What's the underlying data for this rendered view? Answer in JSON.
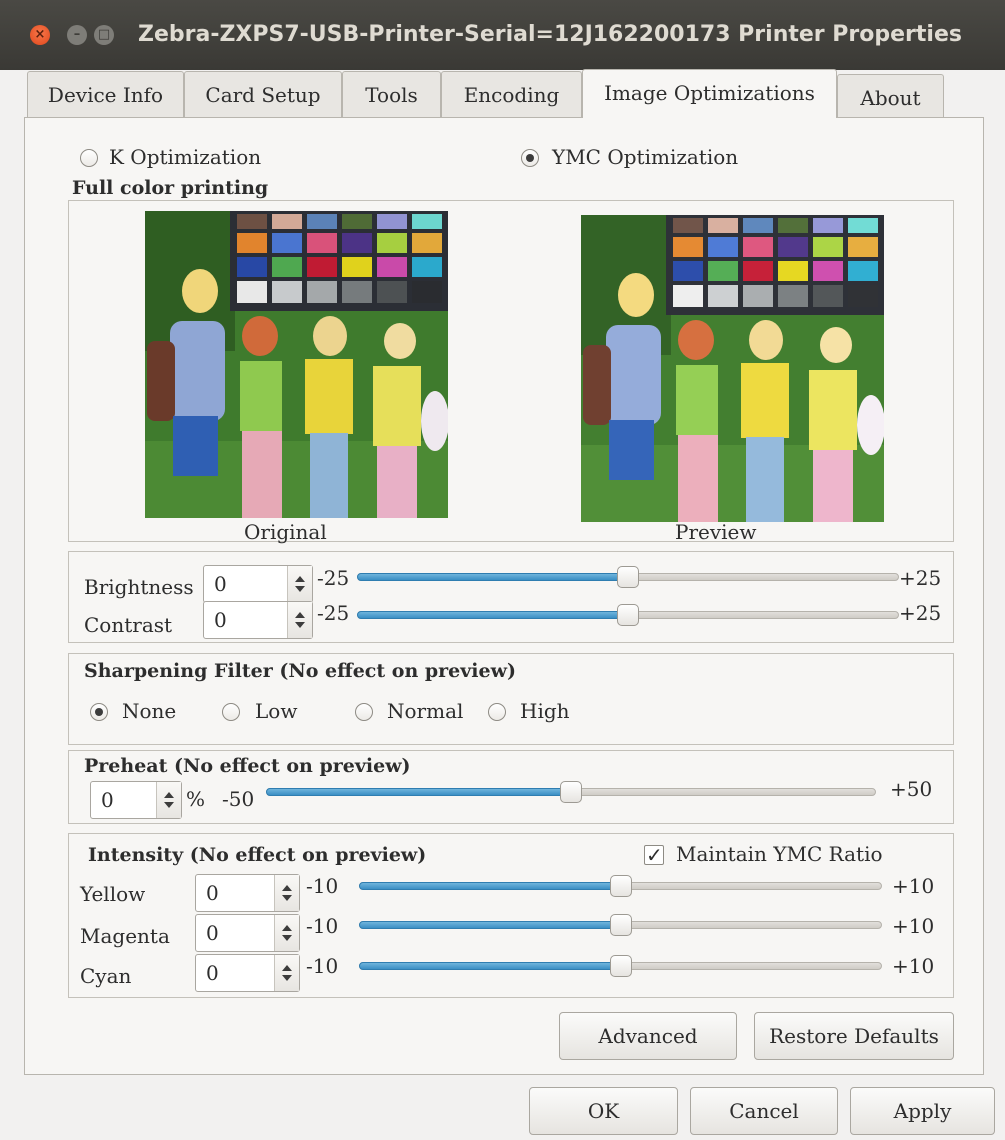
{
  "window": {
    "title": "Zebra-ZXPS7-USB-Printer-Serial=12J162200173 Printer Properties",
    "close_glyph": "×",
    "min_glyph": "–",
    "max_glyph": "□"
  },
  "tabs": [
    {
      "label": "Device Info"
    },
    {
      "label": "Card Setup"
    },
    {
      "label": "Tools"
    },
    {
      "label": "Encoding"
    },
    {
      "label": "Image Optimizations",
      "active": true
    },
    {
      "label": "About"
    }
  ],
  "optimization": {
    "k_label": "K Optimization",
    "ymc_label": "YMC Optimization",
    "selected": "YMC Optimization"
  },
  "full_color": {
    "heading": "Full color printing",
    "original_caption": "Original",
    "preview_caption": "Preview"
  },
  "adjust": {
    "brightness": {
      "label": "Brightness",
      "value": "0",
      "min": "-25",
      "max": "+25",
      "level": 0.5
    },
    "contrast": {
      "label": "Contrast",
      "value": "0",
      "min": "-25",
      "max": "+25",
      "level": 0.5
    }
  },
  "sharpening": {
    "heading": "Sharpening Filter (No effect on preview)",
    "options": [
      "None",
      "Low",
      "Normal",
      "High"
    ],
    "selected": "None"
  },
  "preheat": {
    "heading": "Preheat (No effect on preview)",
    "value": "0",
    "unit": "%",
    "min": "-50",
    "max": "+50",
    "level": 0.5
  },
  "intensity": {
    "heading": "Intensity (No effect on preview)",
    "maintain_label": "Maintain YMC Ratio",
    "maintain_checked": true,
    "check_glyph": "✓",
    "rows": [
      {
        "label": "Yellow",
        "value": "0",
        "min": "-10",
        "max": "+10",
        "level": 0.5
      },
      {
        "label": "Magenta",
        "value": "0",
        "min": "-10",
        "max": "+10",
        "level": 0.5
      },
      {
        "label": "Cyan",
        "value": "0",
        "min": "-10",
        "max": "+10",
        "level": 0.5
      }
    ]
  },
  "buttons": {
    "advanced": "Advanced",
    "restore": "Restore Defaults",
    "ok": "OK",
    "cancel": "Cancel",
    "apply": "Apply"
  },
  "colors": {
    "slider_fill": "#3b8fc4",
    "titlebar": "#3a3935",
    "close_button": "#e0471c"
  }
}
